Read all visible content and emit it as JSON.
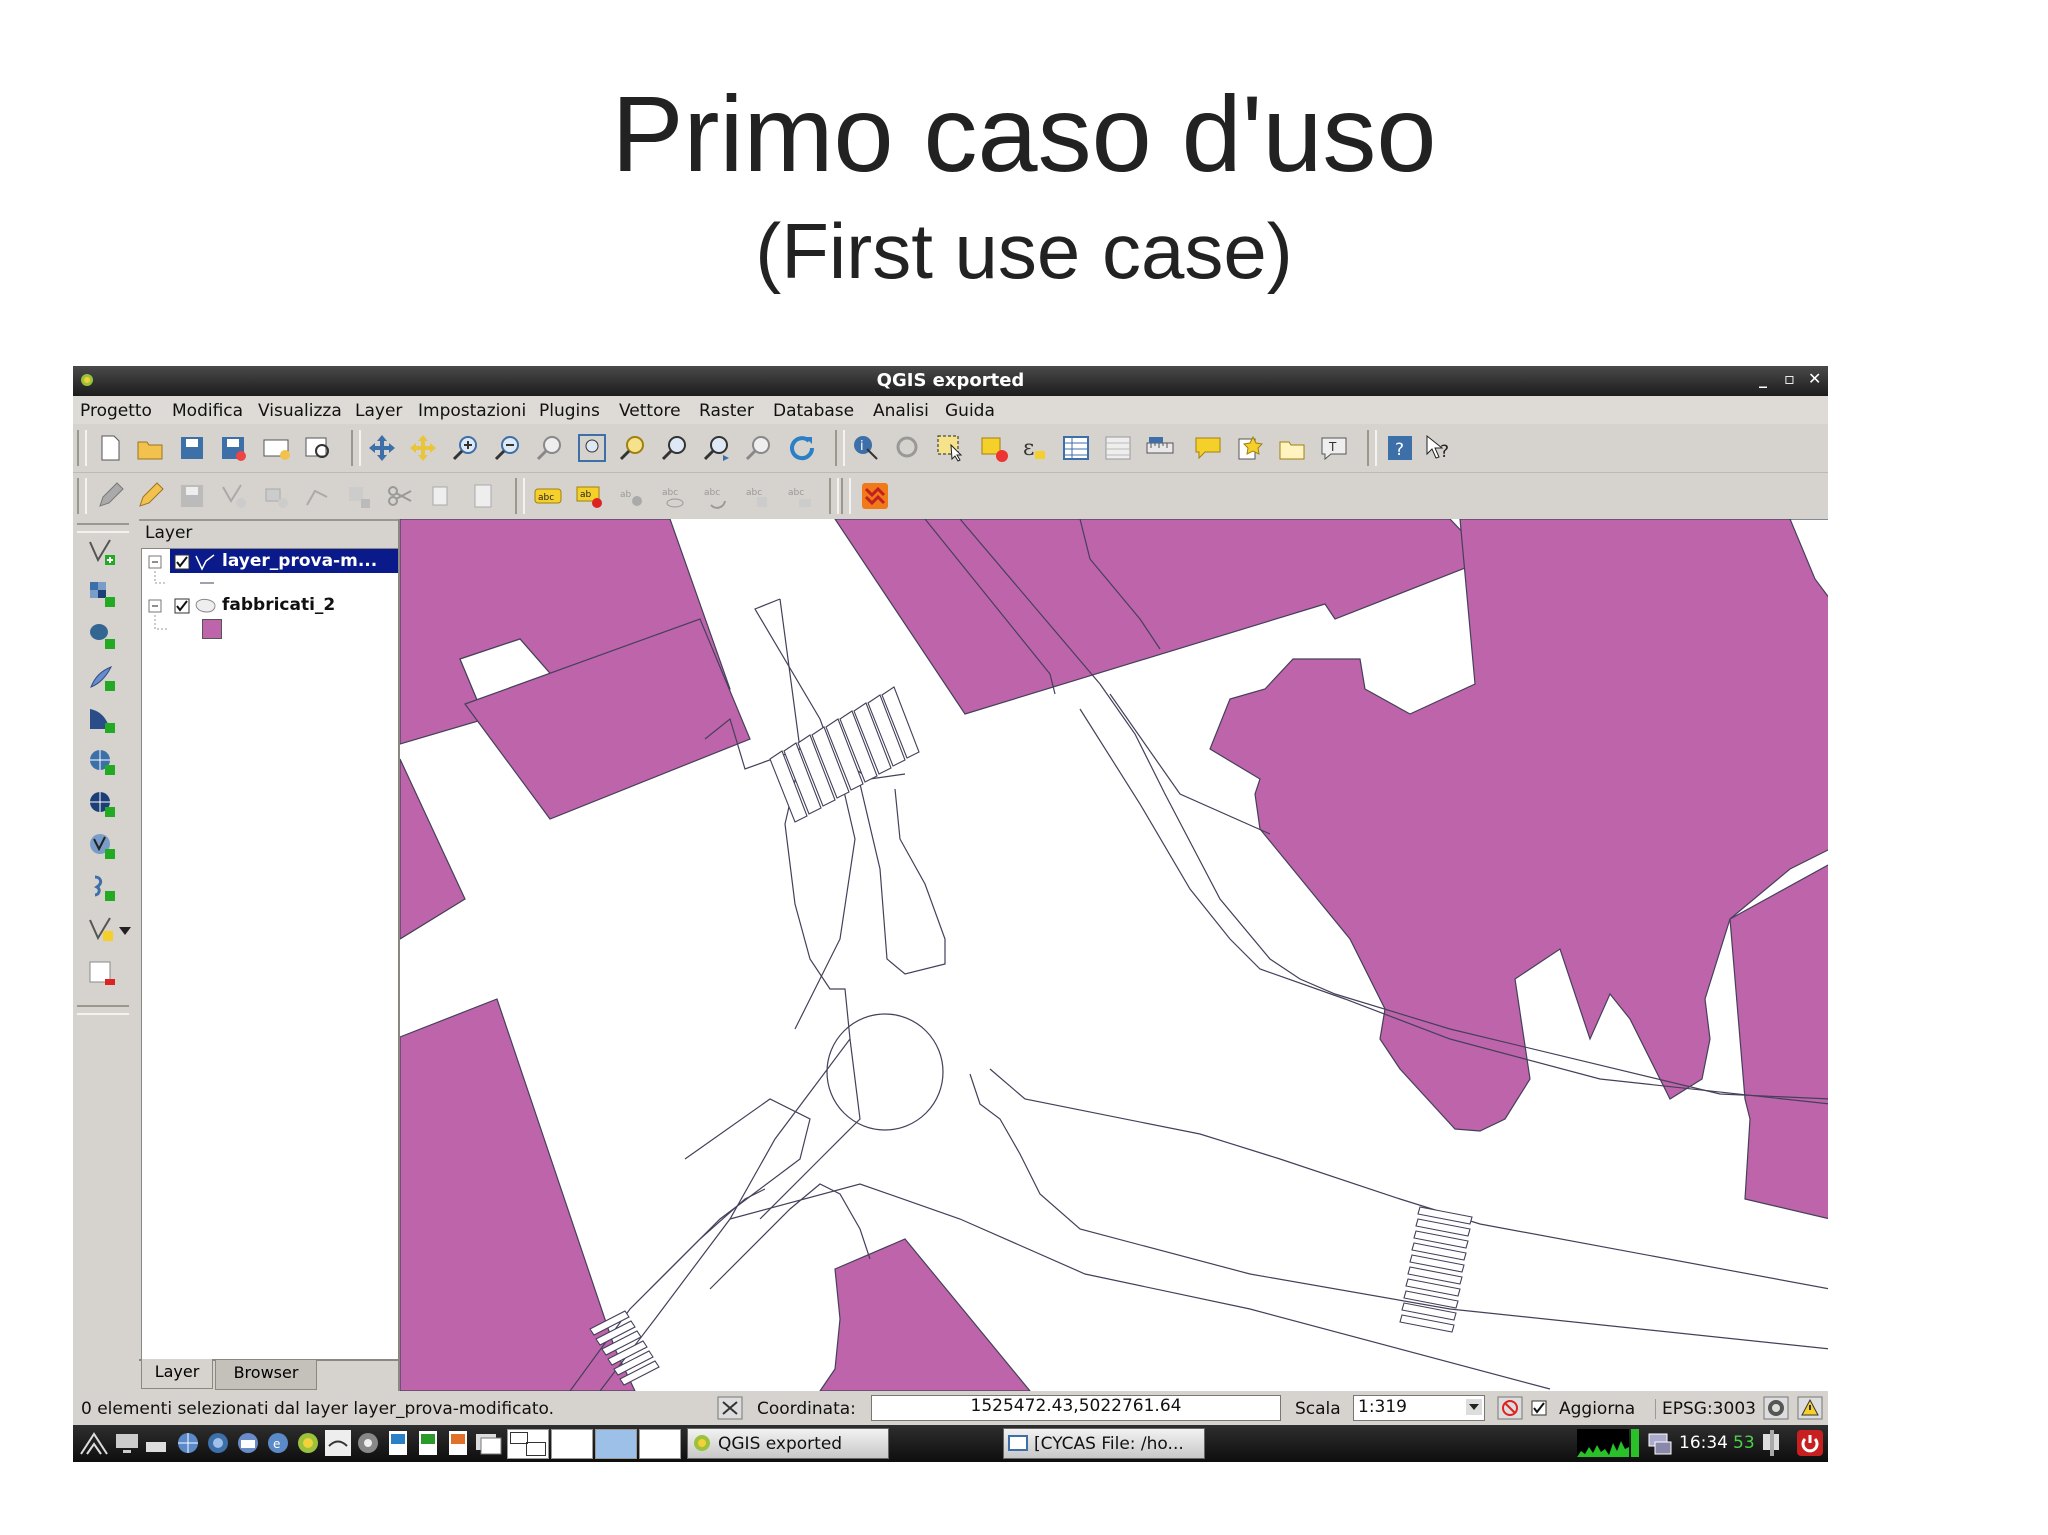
{
  "slide": {
    "title": "Primo caso d'uso",
    "subtitle": "(First use case)"
  },
  "window": {
    "title": "QGIS exported"
  },
  "menubar": {
    "items": [
      "Progetto",
      "Modifica",
      "Visualizza",
      "Layer",
      "Impostazioni",
      "Plugins",
      "Vettore",
      "Raster",
      "Database",
      "Analisi",
      "Guida"
    ]
  },
  "toolbar": {
    "icons_row1": [
      "new-project-icon",
      "open-project-icon",
      "save-project-icon",
      "save-as-icon",
      "new-print-composer-icon",
      "composer-manager-icon",
      "pan-icon",
      "pan-to-selection-icon",
      "zoom-in-icon",
      "zoom-out-icon",
      "zoom-actual-icon",
      "zoom-full-icon",
      "zoom-to-selection-icon",
      "zoom-to-layer-icon",
      "zoom-last-icon",
      "zoom-next-icon",
      "refresh-icon",
      "identify-icon",
      "action-icon",
      "select-icon",
      "deselect-icon",
      "expression-select-icon",
      "attribute-table-icon",
      "field-calculator-icon",
      "measure-icon",
      "map-tips-icon",
      "new-bookmark-icon",
      "show-bookmarks-icon",
      "text-annotation-icon",
      "help-contents-icon",
      "whats-this-icon"
    ],
    "icons_row2": [
      "toggle-editing-icon",
      "current-edits-icon",
      "save-edits-icon",
      "add-feature-icon",
      "move-feature-icon",
      "node-tool-icon",
      "delete-selected-icon",
      "cut-features-icon",
      "copy-features-icon",
      "paste-features-icon",
      "label-icon",
      "label-pin-icon",
      "label-move-icon",
      "label-show-hide-icon",
      "label-rotate-icon",
      "label-change-icon",
      "label-highlight-icon",
      "plugin-icon"
    ]
  },
  "leftbar": {
    "icons": [
      "add-vector-layer-icon",
      "add-raster-layer-icon",
      "add-postgis-layer-icon",
      "add-spatialite-layer-icon",
      "add-mssql-layer-icon",
      "add-wms-layer-icon",
      "add-wcs-layer-icon",
      "add-wfs-layer-icon",
      "add-delimited-text-icon",
      "new-shapefile-icon",
      "remove-layer-icon"
    ]
  },
  "layer_panel": {
    "title": "Layer",
    "layers": [
      {
        "name": "layer_prova-m...",
        "checked": true,
        "selected": true,
        "type": "line"
      },
      {
        "name": "fabbricati_2",
        "checked": true,
        "selected": false,
        "type": "polygon",
        "fill": "#be64aa"
      }
    ],
    "tabs": [
      "Layer",
      "Browser"
    ],
    "active_tab": "Layer"
  },
  "map": {
    "building_fill": "#be64aa",
    "line_color": "#44405a"
  },
  "statusbar": {
    "message": "0 elementi selezionati dal layer layer_prova-modificato.",
    "coord_label": "Coordinata:",
    "coord_value": "1525472.43,5022761.64",
    "scale_label": "Scala",
    "scale_value": "1:319",
    "refresh_label": "Aggiorna",
    "refresh_checked": true,
    "crs": "EPSG:3003"
  },
  "taskbar": {
    "tasks": [
      "QGIS exported",
      "[CYCAS  File: /ho..."
    ],
    "clock": "16:34",
    "cpu": "53"
  }
}
